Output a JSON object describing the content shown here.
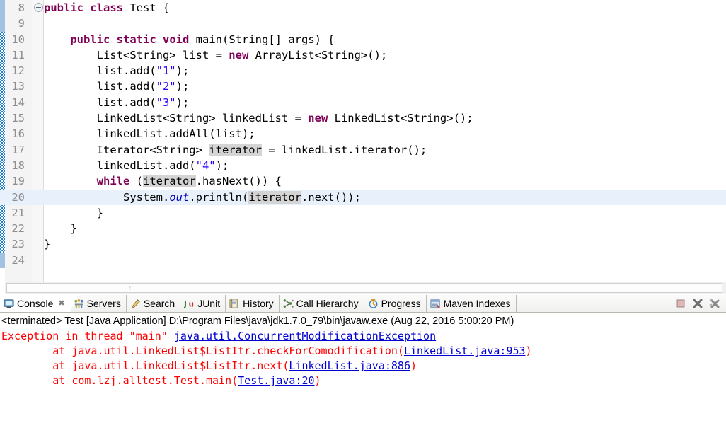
{
  "editor": {
    "first_visible_line": 8,
    "current_line": 20,
    "folded_marker_line": 10,
    "occurrence_highlight_token": "iterator",
    "lines": [
      {
        "num": "8",
        "segments": [
          {
            "t": "public",
            "c": "kw"
          },
          {
            "t": " ",
            "c": ""
          },
          {
            "t": "class",
            "c": "kw"
          },
          {
            "t": " Test {",
            "c": ""
          }
        ]
      },
      {
        "num": "9",
        "segments": [
          {
            "t": "",
            "c": ""
          }
        ]
      },
      {
        "num": "10",
        "segments": [
          {
            "t": "    ",
            "c": ""
          },
          {
            "t": "public",
            "c": "kw"
          },
          {
            "t": " ",
            "c": ""
          },
          {
            "t": "static",
            "c": "kw"
          },
          {
            "t": " ",
            "c": ""
          },
          {
            "t": "void",
            "c": "kw"
          },
          {
            "t": " main(String[] args) {",
            "c": ""
          }
        ]
      },
      {
        "num": "11",
        "segments": [
          {
            "t": "        List<String> list = ",
            "c": ""
          },
          {
            "t": "new",
            "c": "kw"
          },
          {
            "t": " ArrayList<String>();",
            "c": ""
          }
        ]
      },
      {
        "num": "12",
        "segments": [
          {
            "t": "        list.add(",
            "c": ""
          },
          {
            "t": "\"1\"",
            "c": "str"
          },
          {
            "t": ");",
            "c": ""
          }
        ]
      },
      {
        "num": "13",
        "segments": [
          {
            "t": "        list.add(",
            "c": ""
          },
          {
            "t": "\"2\"",
            "c": "str"
          },
          {
            "t": ");",
            "c": ""
          }
        ]
      },
      {
        "num": "14",
        "segments": [
          {
            "t": "        list.add(",
            "c": ""
          },
          {
            "t": "\"3\"",
            "c": "str"
          },
          {
            "t": ");",
            "c": ""
          }
        ]
      },
      {
        "num": "15",
        "segments": [
          {
            "t": "        LinkedList<String> linkedList = ",
            "c": ""
          },
          {
            "t": "new",
            "c": "kw"
          },
          {
            "t": " LinkedList<String>();",
            "c": ""
          }
        ]
      },
      {
        "num": "16",
        "segments": [
          {
            "t": "        linkedList.addAll(list);",
            "c": ""
          }
        ]
      },
      {
        "num": "17",
        "segments": [
          {
            "t": "        Iterator<String> ",
            "c": ""
          },
          {
            "t": "iterator",
            "c": "occ"
          },
          {
            "t": " = linkedList.iterator();",
            "c": ""
          }
        ]
      },
      {
        "num": "18",
        "segments": [
          {
            "t": "        linkedList.add(",
            "c": ""
          },
          {
            "t": "\"4\"",
            "c": "str"
          },
          {
            "t": ");",
            "c": ""
          }
        ]
      },
      {
        "num": "19",
        "segments": [
          {
            "t": "        ",
            "c": ""
          },
          {
            "t": "while",
            "c": "kw"
          },
          {
            "t": " (",
            "c": ""
          },
          {
            "t": "iterator",
            "c": "occ"
          },
          {
            "t": ".hasNext()) {",
            "c": ""
          }
        ]
      },
      {
        "num": "20",
        "segments": [
          {
            "t": "            System.",
            "c": ""
          },
          {
            "t": "out",
            "c": "fld"
          },
          {
            "t": ".println(",
            "c": ""
          },
          {
            "t": "i",
            "c": "occ"
          },
          {
            "t": "|CARET|",
            "c": "caret"
          },
          {
            "t": "terator",
            "c": "occ"
          },
          {
            "t": ".next());",
            "c": ""
          }
        ]
      },
      {
        "num": "21",
        "segments": [
          {
            "t": "        }",
            "c": ""
          }
        ]
      },
      {
        "num": "22",
        "segments": [
          {
            "t": "    }",
            "c": ""
          }
        ]
      },
      {
        "num": "23",
        "segments": [
          {
            "t": "}",
            "c": ""
          }
        ]
      },
      {
        "num": "24",
        "segments": [
          {
            "t": "",
            "c": ""
          }
        ]
      }
    ]
  },
  "console_panel": {
    "tabs": [
      {
        "label": "Console",
        "icon": "console-icon",
        "active": true,
        "closable": true
      },
      {
        "label": "Servers",
        "icon": "servers-icon",
        "active": false,
        "closable": false
      },
      {
        "label": "Search",
        "icon": "search-icon",
        "active": false,
        "closable": false
      },
      {
        "label": "JUnit",
        "icon": "junit-icon",
        "active": false,
        "closable": false
      },
      {
        "label": "History",
        "icon": "history-icon",
        "active": false,
        "closable": false
      },
      {
        "label": "Call Hierarchy",
        "icon": "call-hierarchy-icon",
        "active": false,
        "closable": false
      },
      {
        "label": "Progress",
        "icon": "progress-icon",
        "active": false,
        "closable": false
      },
      {
        "label": "Maven Indexes",
        "icon": "maven-indexes-icon",
        "active": false,
        "closable": false
      }
    ],
    "toolbar": [
      {
        "name": "terminate-button",
        "title": "Terminate"
      },
      {
        "name": "remove-button",
        "title": "Remove Launch"
      },
      {
        "name": "remove-all-button",
        "title": "Remove All Terminated Launches"
      }
    ],
    "launch_header": "<terminated> Test [Java Application] D:\\Program Files\\java\\jdk1.7.0_79\\bin\\javaw.exe (Aug 22, 2016 5:00:20 PM)",
    "output_lines": [
      {
        "parts": [
          {
            "t": "Exception in thread \"main\" ",
            "c": "err"
          },
          {
            "t": "java.util.ConcurrentModificationException",
            "c": "lnk"
          }
        ]
      },
      {
        "parts": [
          {
            "t": "        at java.util.LinkedList$ListItr.checkForComodification(",
            "c": "err"
          },
          {
            "t": "LinkedList.java:953",
            "c": "lnk"
          },
          {
            "t": ")",
            "c": "err"
          }
        ]
      },
      {
        "parts": [
          {
            "t": "        at java.util.LinkedList$ListItr.next(",
            "c": "err"
          },
          {
            "t": "LinkedList.java:886",
            "c": "lnk"
          },
          {
            "t": ")",
            "c": "err"
          }
        ]
      },
      {
        "parts": [
          {
            "t": "        at com.lzj.alltest.Test.main(",
            "c": "err"
          },
          {
            "t": "Test.java:20",
            "c": "lnk"
          },
          {
            "t": ")",
            "c": "err"
          }
        ]
      }
    ]
  },
  "colors": {
    "keyword": "#7f0055",
    "string": "#2a00ff",
    "field": "#0000c0",
    "error_text": "#ff0000",
    "link": "#0000d0",
    "current_line": "#e8f1fb",
    "occurrence": "#d4d4d4",
    "change_bar": "#1a7fd4"
  }
}
